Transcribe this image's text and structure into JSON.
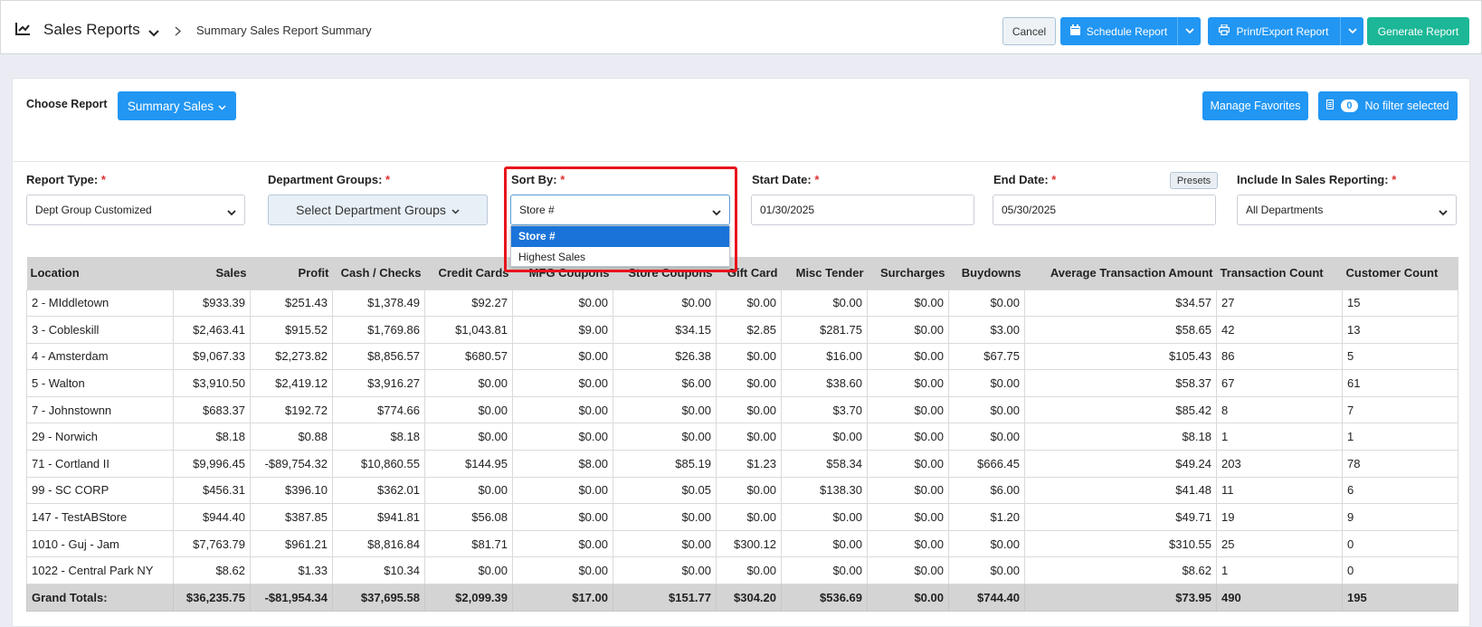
{
  "header": {
    "app_title": "Sales Reports",
    "breadcrumb": "Summary Sales Report Summary",
    "cancel_label": "Cancel",
    "schedule_label": "Schedule Report",
    "print_label": "Print/Export Report",
    "generate_label": "Generate Report"
  },
  "toolbar": {
    "choose_label": "Choose Report",
    "report_button": "Summary Sales",
    "favorites_button": "Manage Favorites",
    "filter_count": "0",
    "filter_label": "No filter selected"
  },
  "filters": {
    "report_type_label": "Report Type:",
    "report_type_value": "Dept Group Customized",
    "dept_groups_label": "Department Groups:",
    "dept_groups_button": "Select Department Groups",
    "sort_by_label": "Sort By:",
    "sort_by_value": "Store #",
    "sort_options": [
      "Store #",
      "Highest Sales"
    ],
    "start_date_label": "Start Date:",
    "start_date_value": "01/30/2025",
    "end_date_label": "End Date:",
    "end_date_value": "05/30/2025",
    "presets_label": "Presets",
    "include_label": "Include In Sales Reporting:",
    "include_value": "All Departments",
    "required_mark": "*"
  },
  "table": {
    "columns": [
      "Location",
      "Sales",
      "Profit",
      "Cash / Checks",
      "Credit Cards",
      "MFG Coupons",
      "Store Coupons",
      "Gift Card",
      "Misc Tender",
      "Surcharges",
      "Buydowns",
      "Average Transaction Amount",
      "Transaction Count",
      "Customer Count"
    ],
    "rows": [
      [
        "2 - MIddletown",
        "$933.39",
        "$251.43",
        "$1,378.49",
        "$92.27",
        "$0.00",
        "$0.00",
        "$0.00",
        "$0.00",
        "$0.00",
        "$0.00",
        "$34.57",
        "27",
        "15"
      ],
      [
        "3 - Cobleskill",
        "$2,463.41",
        "$915.52",
        "$1,769.86",
        "$1,043.81",
        "$9.00",
        "$34.15",
        "$2.85",
        "$281.75",
        "$0.00",
        "$3.00",
        "$58.65",
        "42",
        "13"
      ],
      [
        "4 - Amsterdam",
        "$9,067.33",
        "$2,273.82",
        "$8,856.57",
        "$680.57",
        "$0.00",
        "$26.38",
        "$0.00",
        "$16.00",
        "$0.00",
        "$67.75",
        "$105.43",
        "86",
        "5"
      ],
      [
        "5 - Walton",
        "$3,910.50",
        "$2,419.12",
        "$3,916.27",
        "$0.00",
        "$0.00",
        "$6.00",
        "$0.00",
        "$38.60",
        "$0.00",
        "$0.00",
        "$58.37",
        "67",
        "61"
      ],
      [
        "7 - Johnstownn",
        "$683.37",
        "$192.72",
        "$774.66",
        "$0.00",
        "$0.00",
        "$0.00",
        "$0.00",
        "$3.70",
        "$0.00",
        "$0.00",
        "$85.42",
        "8",
        "7"
      ],
      [
        "29 - Norwich",
        "$8.18",
        "$0.88",
        "$8.18",
        "$0.00",
        "$0.00",
        "$0.00",
        "$0.00",
        "$0.00",
        "$0.00",
        "$0.00",
        "$8.18",
        "1",
        "1"
      ],
      [
        "71 - Cortland II",
        "$9,996.45",
        "-$89,754.32",
        "$10,860.55",
        "$144.95",
        "$8.00",
        "$85.19",
        "$1.23",
        "$58.34",
        "$0.00",
        "$666.45",
        "$49.24",
        "203",
        "78"
      ],
      [
        "99 - SC CORP",
        "$456.31",
        "$396.10",
        "$362.01",
        "$0.00",
        "$0.00",
        "$0.05",
        "$0.00",
        "$138.30",
        "$0.00",
        "$6.00",
        "$41.48",
        "11",
        "6"
      ],
      [
        "147 - TestABStore",
        "$944.40",
        "$387.85",
        "$941.81",
        "$56.08",
        "$0.00",
        "$0.00",
        "$0.00",
        "$0.00",
        "$0.00",
        "$1.20",
        "$49.71",
        "19",
        "9"
      ],
      [
        "1010 - Guj - Jam",
        "$7,763.79",
        "$961.21",
        "$8,816.84",
        "$81.71",
        "$0.00",
        "$0.00",
        "$300.12",
        "$0.00",
        "$0.00",
        "$0.00",
        "$310.55",
        "25",
        "0"
      ],
      [
        "1022 - Central Park NY",
        "$8.62",
        "$1.33",
        "$10.34",
        "$0.00",
        "$0.00",
        "$0.00",
        "$0.00",
        "$0.00",
        "$0.00",
        "$0.00",
        "$8.62",
        "1",
        "0"
      ]
    ],
    "totals": [
      "Grand Totals:",
      "$36,235.75",
      "-$81,954.34",
      "$37,695.58",
      "$2,099.39",
      "$17.00",
      "$151.77",
      "$304.20",
      "$536.69",
      "$0.00",
      "$744.40",
      "$73.95",
      "490",
      "195"
    ]
  },
  "colors": {
    "primary": "#2196f3",
    "success": "#1bb796",
    "highlight": "#e8141c",
    "table_header": "#d4d4d4"
  }
}
